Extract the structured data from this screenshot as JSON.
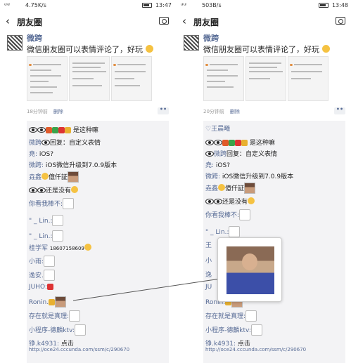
{
  "left": {
    "status": {
      "signal": "ᵘˡ ᵘˡ",
      "speed": "4.75K/s",
      "time": "13:47"
    },
    "nav": {
      "back": "‹",
      "title": "朋友圈"
    },
    "post": {
      "author": "微跨",
      "text": "微信朋友圈可以表情评论了，好玩",
      "time": "18分钟前",
      "delete": "删除",
      "more": "••"
    },
    "comments": [
      {
        "name": "",
        "text": "是这种嘛",
        "icons": true
      },
      {
        "name": "微跨",
        "text": "回复：自定义表情",
        "icons": true
      },
      {
        "name": "堯:",
        "text": " iOS?"
      },
      {
        "name": "微跨:",
        "text": " iOS微信升级到7.0.9版本"
      },
      {
        "name": "垚鑫",
        "text": "億仟証"
      },
      {
        "name": "",
        "text": "还是没有",
        "icons": true
      },
      {
        "name": "你看我棒不:",
        "text": ""
      },
      {
        "name": "\" _ Lin.:",
        "text": ""
      },
      {
        "name": "\" _ Lin.:",
        "text": ""
      },
      {
        "name": "桂学军",
        "text": "18607158609"
      },
      {
        "name": "小雨:",
        "text": ""
      },
      {
        "name": "逸安.",
        "text": ""
      },
      {
        "name": "JUHO:",
        "text": ""
      },
      {
        "name": "Ronin.",
        "text": ""
      },
      {
        "name": "存在就是真理:",
        "text": ""
      },
      {
        "name": "小程序-德麟ktv:",
        "text": ""
      },
      {
        "name": "铮.k4931:",
        "text": " 点击"
      },
      {
        "name": "",
        "text": "http://oce24.cccunda.com/ssm/c/290670"
      }
    ]
  },
  "right": {
    "status": {
      "signal": "ᵘˡ ᵘˡ",
      "speed": "503B/s",
      "time": "13:48"
    },
    "nav": {
      "back": "‹",
      "title": "朋友圈"
    },
    "post": {
      "author": "微跨",
      "text": "微信朋友圈可以表情评论了，好玩",
      "time": "20分钟前",
      "delete": "删除",
      "more": "••"
    },
    "likes": "王晨曦",
    "comments": [
      {
        "name": "",
        "text": "是这种嘛",
        "icons": true
      },
      {
        "name": "微跨",
        "text": "回复：自定义表情",
        "icons": true
      },
      {
        "name": "堯:",
        "text": " iOS?"
      },
      {
        "name": "微跨:",
        "text": " iOS微信升级到7.0.9版本"
      },
      {
        "name": "垚鑫",
        "text": "億仟証"
      },
      {
        "name": "",
        "text": "还是没有",
        "icons": true
      },
      {
        "name": "你看我棒不:",
        "text": ""
      },
      {
        "name": "\" _ Lin.:",
        "text": ""
      },
      {
        "name": "王",
        "text": ""
      },
      {
        "name": "小",
        "text": ""
      },
      {
        "name": "逸",
        "text": ""
      },
      {
        "name": "JU",
        "text": ""
      },
      {
        "name": "Ronin.",
        "text": ""
      },
      {
        "name": "存在就是真理:",
        "text": ""
      },
      {
        "name": "小程序-德麟ktv:",
        "text": ""
      },
      {
        "name": "铮.k4931:",
        "text": " 点击"
      },
      {
        "name": "",
        "text": "http://oce24.cccunda.com/ssm/c/290670"
      }
    ]
  }
}
